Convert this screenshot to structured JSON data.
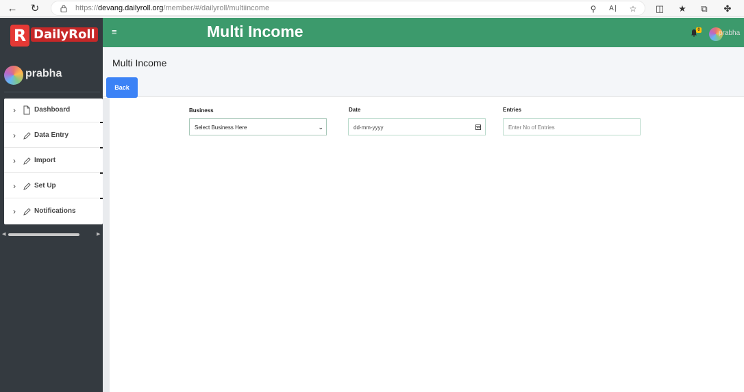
{
  "browser": {
    "url_prefix": "https://",
    "url_host": "devang.dailyroll.org",
    "url_path": "/member/#/dailyroll/multiincome",
    "back_icon": "arrow-left-icon",
    "reload_icon": "reload-icon"
  },
  "sidebar": {
    "logo_letter": "R",
    "logo_text": "DailyRoll",
    "user_name": "prabha",
    "menu": [
      {
        "label": "Dashboard",
        "icon": "file-icon"
      },
      {
        "label": "Data Entry",
        "icon": "pencil-icon"
      },
      {
        "label": "Import",
        "icon": "pencil-icon"
      },
      {
        "label": "Set Up",
        "icon": "pencil-icon"
      },
      {
        "label": "Notifications",
        "icon": "pencil-icon"
      }
    ]
  },
  "header": {
    "toggle": "≡",
    "title": "Multi Income",
    "notification_count": "0",
    "user_name": "prabha",
    "color": "#3c9a6c"
  },
  "page": {
    "title": "Multi Income",
    "back_label": "Back"
  },
  "form": {
    "business": {
      "label": "Business",
      "value": "Select Business Here"
    },
    "date": {
      "label": "Date",
      "placeholder": "dd-mm-yyyy"
    },
    "entries": {
      "label": "Entries",
      "placeholder": "Enter No of Entries"
    }
  },
  "colors": {
    "sidebar": "#343a40",
    "accent_button": "#3b82f6",
    "badge": "#ffc107"
  }
}
